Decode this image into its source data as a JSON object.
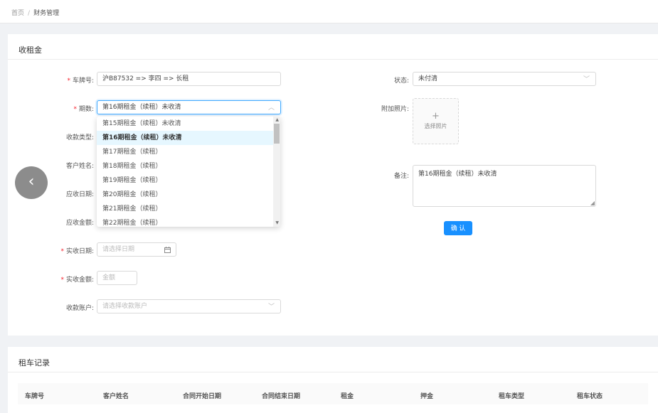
{
  "breadcrumb": {
    "home": "首页",
    "separator": "/",
    "current": "财务管理"
  },
  "form_card": {
    "title": "收租金",
    "plate_label": "车牌号:",
    "plate_value": "沪B87532 => 李四 => 长租",
    "period_label": "期数:",
    "period_value": "第16期租金（续租）未收清",
    "collect_type_label": "收款类型:",
    "customer_label": "客户姓名:",
    "due_date_label": "应收日期:",
    "due_amount_label": "应收金额:",
    "actual_date_label": "实收日期:",
    "actual_date_placeholder": "请选择日期",
    "actual_amount_label": "实收金额:",
    "actual_amount_placeholder": "金额",
    "account_label": "收款账户:",
    "account_placeholder": "请选择收款账户",
    "status_label": "状态:",
    "status_value": "未付清",
    "photo_label": "附加照片:",
    "photo_plus": "+",
    "photo_text": "选择照片",
    "remark_label": "备注:",
    "remark_value": "第16期租金（续租）未收清",
    "confirm_label": "确 认",
    "back_glyph": "‹",
    "required_mark": "*"
  },
  "period_options": [
    "第15期租金（续租）未收清",
    "第16期租金（续租）未收清",
    "第17期租金（续租）",
    "第18期租金（续租）",
    "第19期租金（续租）",
    "第20期租金（续租）",
    "第21期租金（续租）",
    "第22期租金（续租）"
  ],
  "selected_option_index": 1,
  "records_card": {
    "title": "租车记录",
    "columns": [
      "车牌号",
      "客户姓名",
      "合同开始日期",
      "合同结束日期",
      "租金",
      "押金",
      "租车类型",
      "租车状态"
    ]
  },
  "colors": {
    "primary": "#1890ff",
    "required": "#f5222d",
    "selected_bg": "#e6f7ff"
  }
}
